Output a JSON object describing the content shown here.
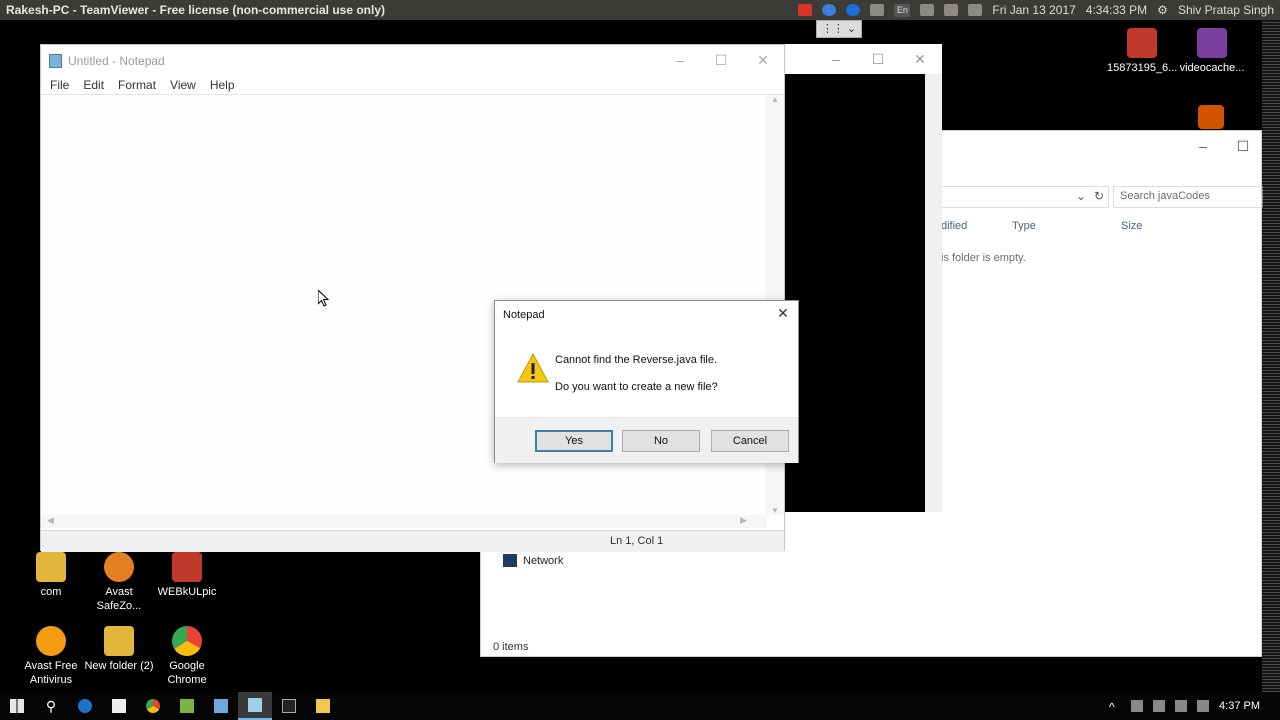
{
  "topbar": {
    "title": "Rakesh-PC - TeamViewer - Free license (non-commercial use only)",
    "lang": "En",
    "datetime": "Fri Jan 13 2017",
    "time": "4:34:33 PM",
    "user": "Shiv Pratap Singh"
  },
  "desktop_icons": [
    {
      "label": "15873195_6...",
      "color": "#c0392b"
    },
    {
      "label": "videocache...",
      "color": "#7b3fa0"
    },
    {
      "label": "com",
      "color": "#e2b53b"
    },
    {
      "label": "Avast SafeZo...",
      "color": "#e67e22"
    },
    {
      "label": "WEBkULpic",
      "color": "#c0392b"
    },
    {
      "label": "Avast Free Antivirus",
      "color": "#f39c12"
    },
    {
      "label": "New folder (2)",
      "color": "#e2b53b"
    },
    {
      "label": "Google Chrome",
      "color": "#34a853"
    }
  ],
  "explorer": {
    "search_placeholder": "Search javaCodes",
    "col_modified": "dified",
    "col_type": "Type",
    "col_size": "Size",
    "empty_text": "is folder is empty.",
    "nav_network": "Network",
    "status": "0 items"
  },
  "notepad": {
    "title": "Untitled - Notepad",
    "menu": [
      "File",
      "Edit",
      "Format",
      "View",
      "Help"
    ],
    "status_pos": "Ln 1, Col 1"
  },
  "dialog": {
    "title": "Notepad",
    "line1": "Cannot find the Reverse.java file.",
    "line2": "Do you want to create a new file?",
    "yes": "Yes",
    "no": "No",
    "cancel": "Cancel"
  },
  "taskbar": {
    "time": "4:37 PM"
  }
}
